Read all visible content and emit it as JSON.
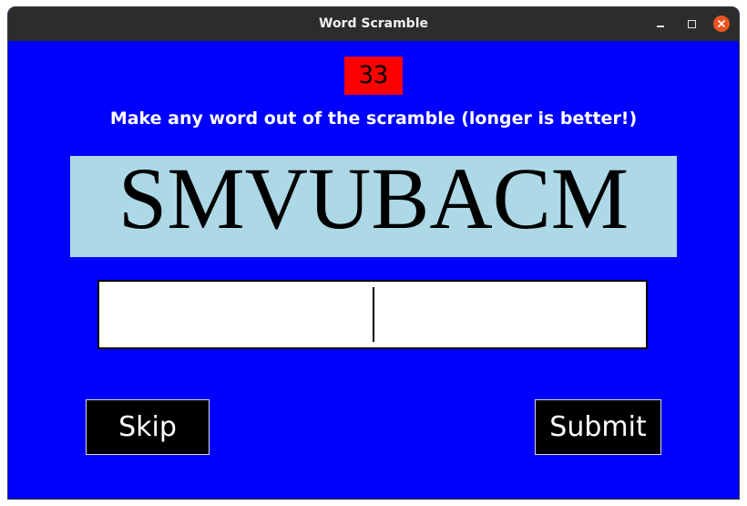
{
  "window": {
    "title": "Word Scramble",
    "controls": {
      "minimize_icon": "minimize-icon",
      "maximize_icon": "maximize-icon",
      "close_icon": "close-icon"
    }
  },
  "game": {
    "timer": "33",
    "instructions": "Make any word out of the scramble (longer is better!)",
    "scramble": "SMVUBACM",
    "answer_value": "",
    "skip_label": "Skip",
    "submit_label": "Submit"
  },
  "colors": {
    "background": "#0000ff",
    "timer_background": "#ff0000",
    "scramble_background": "#add8e6",
    "button_background": "#000000",
    "close_button": "#e95420",
    "titlebar": "#2c2c2c"
  }
}
